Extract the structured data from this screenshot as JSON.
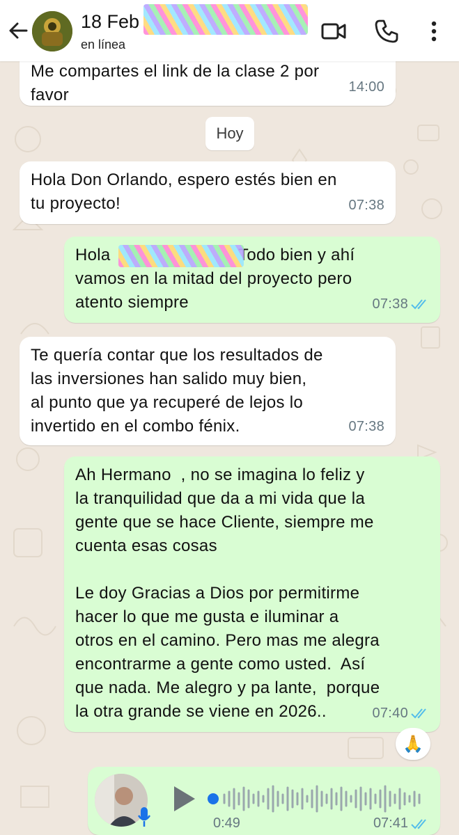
{
  "header": {
    "title": "18 Feb",
    "status": "en línea",
    "back_icon": "arrow-left-icon",
    "video_icon": "video-camera-icon",
    "call_icon": "phone-icon",
    "menu_icon": "more-vertical-icon"
  },
  "date_chip": "Hoy",
  "messages": [
    {
      "dir": "in",
      "text": "Me compartes el link de la clase 2 por\nfavor",
      "time": "14:00"
    },
    {
      "dir": "in",
      "text": "Hola Don Orlando, espero estés bien en\ntu proyecto!",
      "time": "07:38"
    },
    {
      "dir": "out",
      "text_before": "Hola ",
      "text_after": " Todo bien y ahí\nvamos en la mitad del proyecto pero\natento siempre",
      "time": "07:38",
      "read": true
    },
    {
      "dir": "in",
      "text": "Te quería contar que los resultados de\nlas inversiones han salido muy bien,\nal punto que ya recuperé de lejos lo\ninvertido en el combo fénix.",
      "time": "07:38"
    },
    {
      "dir": "out",
      "text": "Ah Hermano  , no se imagina lo feliz y\nla tranquilidad que da a mi vida que la\ngente que se hace Cliente, siempre me\ncuenta esas cosas\n\nLe doy Gracias a Dios por permitirme\nhacer lo que me gusta e iluminar a\notros en el camino. Pero mas me alegra\nencontrarme a gente como usted.  Así\nque nada. Me alegro y pa lante,  porque\nla otra grande se viene en 2026..",
      "time": "07:40",
      "read": true,
      "reaction": "🙏"
    }
  ],
  "voice_note": {
    "duration": "0:49",
    "time": "07:41",
    "read": true,
    "play_icon": "play-icon",
    "mic_icon": "microphone-icon"
  },
  "colors": {
    "incoming_bubble": "#ffffff",
    "outgoing_bubble": "#d9fdd3",
    "read_ticks": "#53bdeb",
    "wallpaper": "#efe7de",
    "voice_dot": "#1a73e8"
  }
}
